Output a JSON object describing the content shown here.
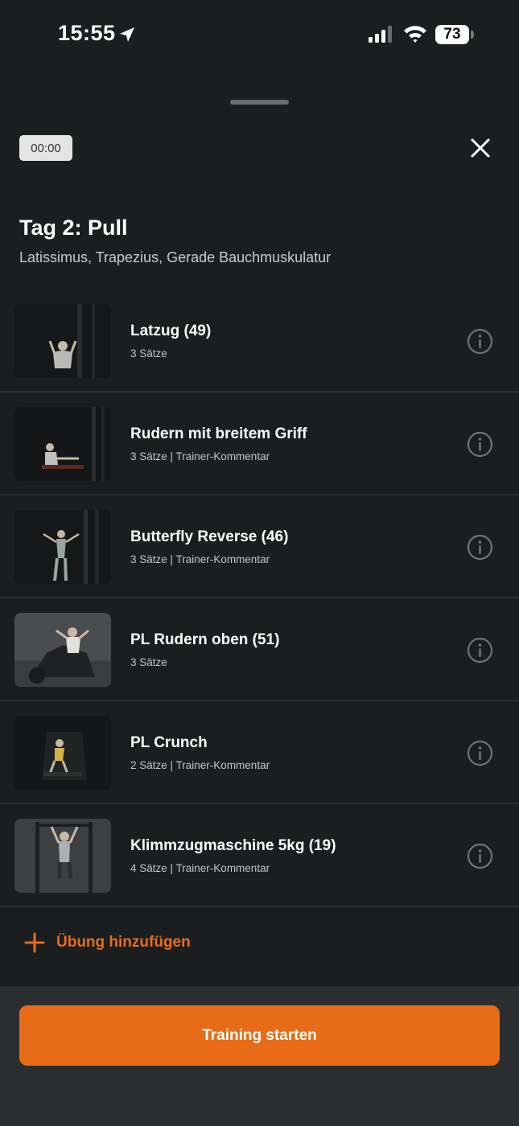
{
  "status_bar": {
    "time": "15:55",
    "battery": "73",
    "icons": [
      "location-arrow-icon",
      "cellular-signal-icon",
      "wifi-icon",
      "battery-icon"
    ]
  },
  "sheet": {
    "timer": "00:00",
    "close_icon": "close-icon"
  },
  "workout": {
    "title": "Tag 2: Pull",
    "subtitle": "Latissimus, Trapezius, Gerade Bauchmuskulatur"
  },
  "exercises": [
    {
      "name": "Latzug (49)",
      "meta": "3 Sätze",
      "icon": "info-icon"
    },
    {
      "name": "Rudern mit breitem Griff",
      "meta": "3 Sätze | Trainer-Kommentar",
      "icon": "info-icon"
    },
    {
      "name": "Butterfly Reverse (46)",
      "meta": "3 Sätze | Trainer-Kommentar",
      "icon": "info-icon"
    },
    {
      "name": "PL Rudern oben (51)",
      "meta": "3 Sätze",
      "icon": "info-icon"
    },
    {
      "name": "PL Crunch",
      "meta": "2 Sätze | Trainer-Kommentar",
      "icon": "info-icon"
    },
    {
      "name": "Klimmzugmaschine 5kg (19)",
      "meta": "4 Sätze | Trainer-Kommentar",
      "icon": "info-icon"
    }
  ],
  "add_exercise": {
    "label": "Übung hinzufügen",
    "icon": "plus-icon"
  },
  "start_button": {
    "label": "Training starten"
  },
  "colors": {
    "background": "#1b1e1f",
    "accent": "#e86c17",
    "divider": "#2c3033",
    "bottom_bar": "#2a2e30"
  }
}
